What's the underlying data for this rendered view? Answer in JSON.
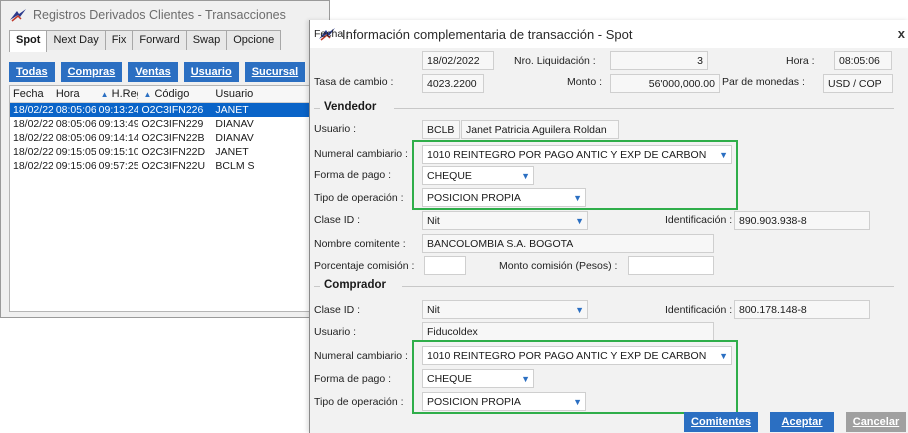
{
  "bg": {
    "title": "Registros Derivados Clientes - Transacciones",
    "tabs": [
      "Spot",
      "Next Day",
      "Fix",
      "Forward",
      "Swap",
      "Opcione"
    ],
    "filters": [
      "Todas",
      "Compras",
      "Ventas",
      "Usuario",
      "Sucursal"
    ],
    "columns": [
      "Fecha",
      "Hora",
      "H.Reg",
      "Código",
      "Usuario"
    ],
    "rows": [
      [
        "18/02/22",
        "08:05:06",
        "09:13:24",
        "O2C3IFN226",
        "JANET"
      ],
      [
        "18/02/22",
        "08:05:06",
        "09:13:49",
        "O2C3IFN229",
        "DIANAV"
      ],
      [
        "18/02/22",
        "08:05:06",
        "09:14:14",
        "O2C3IFN22B",
        "DIANAV"
      ],
      [
        "18/02/22",
        "09:15:05",
        "09:15:10",
        "O2C3IFN22D",
        "JANET"
      ],
      [
        "18/02/22",
        "09:15:06",
        "09:57:25",
        "O2C3IFN22U",
        "BCLM S"
      ]
    ]
  },
  "dialog": {
    "title": "Información complementaria de transacción - Spot",
    "close": "x",
    "fecha_label": "Fecha :",
    "fecha": "18/02/2022",
    "liq_label": "Nro. Liquidación :",
    "liq": "3",
    "hora_label": "Hora :",
    "hora": "08:05:06",
    "tasa_label": "Tasa de cambio :",
    "tasa": "4023.2200",
    "monto_label": "Monto :",
    "monto": "56'000,000.00",
    "par_label": "Par de monedas :",
    "par": "USD / COP",
    "vendedor": {
      "title": "Vendedor",
      "usuario_label": "Usuario :",
      "usuario_code": "BCLB",
      "usuario_name": "Janet Patricia Aguilera Roldan",
      "numeral_label": "Numeral cambiario :",
      "numeral": "1010  REINTEGRO POR PAGO ANTIC Y EXP DE CARBON",
      "forma_label": "Forma de pago :",
      "forma": "CHEQUE",
      "tipo_label": "Tipo de operación :",
      "tipo": "POSICION PROPIA",
      "clase_label": "Clase ID :",
      "clase": "Nit",
      "ident_label": "Identificación :",
      "ident": "890.903.938-8",
      "nombre_label": "Nombre comitente :",
      "nombre": "BANCOLOMBIA S.A.  BOGOTA",
      "porc_label": "Porcentaje comisión :",
      "porc": "",
      "monto_com_label": "Monto comisión (Pesos) :",
      "monto_com": ""
    },
    "comprador": {
      "title": "Comprador",
      "clase_label": "Clase ID :",
      "clase": "Nit",
      "ident_label": "Identificación :",
      "ident": "800.178.148-8",
      "usuario_label": "Usuario :",
      "usuario": "Fiducoldex",
      "numeral_label": "Numeral cambiario :",
      "numeral": "1010  REINTEGRO POR PAGO ANTIC Y EXP DE CARBON",
      "forma_label": "Forma de pago :",
      "forma": "CHEQUE",
      "tipo_label": "Tipo de operación :",
      "tipo": "POSICION PROPIA"
    },
    "buttons": {
      "comitentes": "Comitentes",
      "aceptar": "Aceptar",
      "cancelar": "Cancelar"
    }
  },
  "colors": {
    "accent": "#2b6fc2",
    "selection": "#0a64c8",
    "highlight_box": "#2fae4a"
  }
}
